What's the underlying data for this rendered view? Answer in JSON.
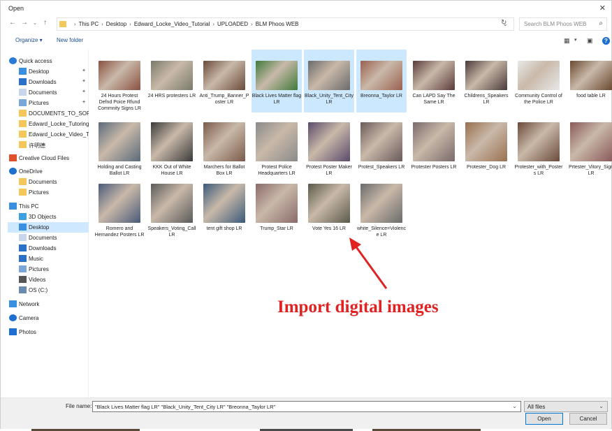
{
  "title": "Open",
  "address": {
    "crumbs": [
      "This PC",
      "Desktop",
      "Edward_Locke_Video_Tutorial",
      "UPLOADED",
      "BLM Phoos WEB"
    ]
  },
  "search": {
    "placeholder": "Search BLM Phoos WEB"
  },
  "toolbar": {
    "organize": "Organize ▾",
    "new_folder": "New folder"
  },
  "sidebar": [
    {
      "label": "Quick access",
      "icon": "star-icon"
    },
    {
      "label": "Desktop",
      "icon": "desktop-icon"
    },
    {
      "label": "Downloads",
      "icon": "download-icon"
    },
    {
      "label": "Documents",
      "icon": "document-icon"
    },
    {
      "label": "Pictures",
      "icon": "pictures-icon"
    },
    {
      "label": "DOCUMENTS_TO_SORT",
      "icon": "folder-icon"
    },
    {
      "label": "Edward_Locke_Tutoring",
      "icon": "folder-icon"
    },
    {
      "label": "Edward_Locke_Video_Tu",
      "icon": "folder-icon"
    },
    {
      "label": "许明德",
      "icon": "folder-icon"
    },
    {
      "label": "Creative Cloud Files",
      "icon": "creative-cloud-icon"
    },
    {
      "label": "OneDrive",
      "icon": "cloud-icon"
    },
    {
      "label": "Documents",
      "icon": "folder-icon"
    },
    {
      "label": "Pictures",
      "icon": "folder-icon"
    },
    {
      "label": "This PC",
      "icon": "computer-icon"
    },
    {
      "label": "3D Objects",
      "icon": "cube-icon"
    },
    {
      "label": "Desktop",
      "icon": "desktop-icon"
    },
    {
      "label": "Documents",
      "icon": "document-icon"
    },
    {
      "label": "Downloads",
      "icon": "download-icon"
    },
    {
      "label": "Music",
      "icon": "music-icon"
    },
    {
      "label": "Pictures",
      "icon": "pictures-icon"
    },
    {
      "label": "Videos",
      "icon": "video-icon"
    },
    {
      "label": "OS (C:)",
      "icon": "drive-icon"
    },
    {
      "label": "Network",
      "icon": "network-icon"
    },
    {
      "label": "Camera",
      "icon": "camera-icon"
    },
    {
      "label": "Photos",
      "icon": "photos-icon"
    }
  ],
  "files": [
    {
      "label": "24 Hours Protest Defnd Poice Rfund Commnity Signs LR",
      "color": "#8a5040",
      "selected": false
    },
    {
      "label": "24 HRS protesters LR",
      "color": "#7a7a6a",
      "selected": false
    },
    {
      "label": "Anti_Trump_Banner_Poster LR",
      "color": "#6a4a3a",
      "selected": false
    },
    {
      "label": "Black Lives Matter flag LR",
      "color": "#3f7a3a",
      "selected": true
    },
    {
      "label": "Black_Unity_Tent_City LR",
      "color": "#6a6a6a",
      "selected": true
    },
    {
      "label": "Breonna_Taylor LR",
      "color": "#9a6050",
      "selected": true
    },
    {
      "label": "Can LAPD Say The Same LR",
      "color": "#5a3a3a",
      "selected": false
    },
    {
      "label": "Childrens_Speakers LR",
      "color": "#4a3a3a",
      "selected": false
    },
    {
      "label": "Community Control of the Police LR",
      "color": "#e8e8e8",
      "selected": false
    },
    {
      "label": "food table LR",
      "color": "#6a4a30",
      "selected": false
    },
    {
      "label": "Holding and Casting Ballot LR",
      "color": "#5a6a7a",
      "selected": false
    },
    {
      "label": "KKK Out of White House LR",
      "color": "#3a3a3a",
      "selected": false
    },
    {
      "label": "Marchers for Ballot Box LR",
      "color": "#7a5a4a",
      "selected": false
    },
    {
      "label": "Protest Police Headquarters LR",
      "color": "#8a8a8a",
      "selected": false
    },
    {
      "label": "Protest Poster Maker LR",
      "color": "#5a4a6a",
      "selected": false
    },
    {
      "label": "Protest_Speakers LR",
      "color": "#6a5a5a",
      "selected": false
    },
    {
      "label": "Protester Posters LR",
      "color": "#7a6a6a",
      "selected": false
    },
    {
      "label": "Protester_Dog LR",
      "color": "#9a7050",
      "selected": false
    },
    {
      "label": "Protester_with_Posters LR",
      "color": "#6a4a3a",
      "selected": false
    },
    {
      "label": "Prtester_Vitory_Sign LR",
      "color": "#8a5a5a",
      "selected": false
    },
    {
      "label": "Romero and Hernandez Posters LR",
      "color": "#4a5a7a",
      "selected": false
    },
    {
      "label": "Speakers_Voting_Call LR",
      "color": "#5a5a5a",
      "selected": false
    },
    {
      "label": "tent gift shop LR",
      "color": "#3a5a7a",
      "selected": false
    },
    {
      "label": "Trump_Star LR",
      "color": "#8a6a6a",
      "selected": false
    },
    {
      "label": "Vote Yes 16 LR",
      "color": "#5a5a4a",
      "selected": false
    },
    {
      "label": "white_Silence=Violence LR",
      "color": "#6a6a6a",
      "selected": false
    }
  ],
  "annotation": "Import digital images",
  "bottom": {
    "filename_label": "File name:",
    "filename_value": "\"Black Lives Matter flag LR\" \"Black_Unity_Tent_City LR\" \"Breonna_Taylor LR\"",
    "filetype": "All files",
    "open": "Open",
    "cancel": "Cancel"
  },
  "colors": {
    "selection": "#cce8ff",
    "annotation": "#e02222",
    "folder": "#f4c75a",
    "accent": "#0078d7"
  }
}
